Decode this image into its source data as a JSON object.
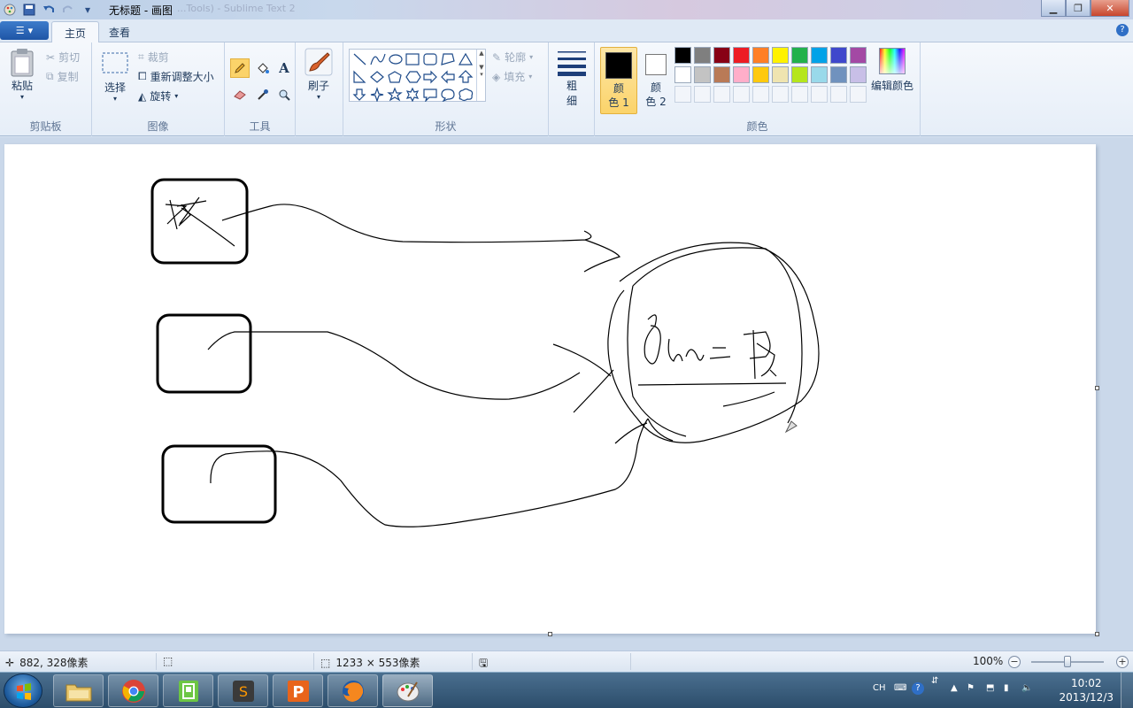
{
  "window": {
    "title": "无标题 - 画图",
    "ghost_title": "...Tools) - Sublime Text 2"
  },
  "tabs": [
    {
      "label": "主页",
      "active": true
    },
    {
      "label": "查看",
      "active": false
    }
  ],
  "ribbon": {
    "clipboard": {
      "group_label": "剪贴板",
      "paste": "粘贴",
      "cut": "剪切",
      "copy": "复制"
    },
    "image": {
      "group_label": "图像",
      "select": "选择",
      "crop": "裁剪",
      "resize": "重新调整大小",
      "rotate": "旋转"
    },
    "tools": {
      "group_label": "工具"
    },
    "brushes": {
      "label": "刷子"
    },
    "shapes": {
      "group_label": "形状",
      "outline": "轮廓",
      "fill": "填充"
    },
    "size": {
      "label_1": "粗",
      "label_2": "细"
    },
    "colors": {
      "group_label": "颜色",
      "color1_label_1": "颜",
      "color1_label_2": "色 1",
      "color2_label_1": "颜",
      "color2_label_2": "色 2",
      "edit_colors": "编辑颜色",
      "color1": "#000000",
      "color2": "#ffffff",
      "palette_row1": [
        "#000000",
        "#7f7f7f",
        "#880015",
        "#ed1c24",
        "#ff7f27",
        "#fff200",
        "#22b14c",
        "#00a2e8",
        "#3f48cc",
        "#a349a4"
      ],
      "palette_row2": [
        "#ffffff",
        "#c3c3c3",
        "#b97a57",
        "#ffaec9",
        "#ffc90e",
        "#efe4b0",
        "#b5e61d",
        "#99d9ea",
        "#7092be",
        "#c8bfe7"
      ]
    }
  },
  "statusbar": {
    "cursor_pos": "882, 328像素",
    "selection_size": "",
    "canvas_size": "1233 × 553像素",
    "zoom": "100%"
  },
  "taskbar": {
    "lang": "CH",
    "time": "10:02",
    "date": "2013/12/3"
  }
}
